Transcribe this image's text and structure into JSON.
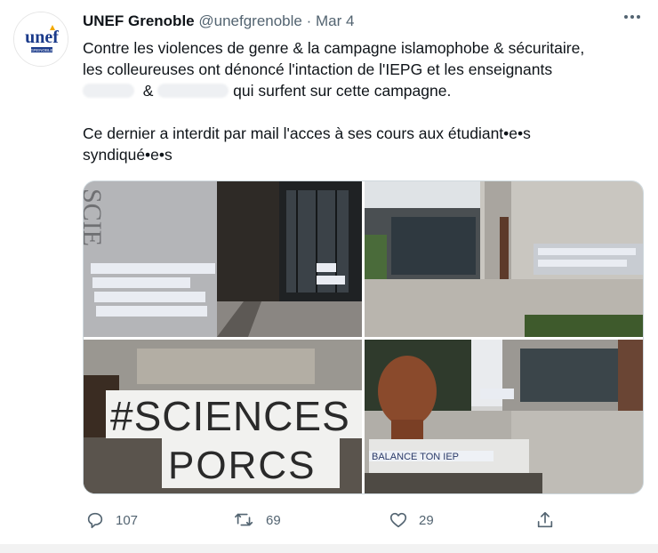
{
  "tweet": {
    "author": {
      "display_name": "UNEF Grenoble",
      "handle": "@unefgrenoble",
      "avatar_logo_text": "unef",
      "avatar_sub_text": "GRENOBLE"
    },
    "separator": "·",
    "date": "Mar 4",
    "more_icon": "more-horizontal-icon",
    "text": {
      "line1": "Contre les violences de genre & la campagne islamophobe & sécuritaire,",
      "line2": "les colleureuses ont dénoncé l'intaction de l'IEPG et les enseignants",
      "line3_amp": "&",
      "line3_rest": "qui surfent sur cette campagne.",
      "para2_line1": "Ce dernier a interdit par mail l'acces à ses cours aux étudiant•e•s",
      "para2_line2": "syndiqué•e•s"
    },
    "photos": {
      "photo1_alt": "collage-on-building-wall",
      "photo3_lines": [
        "#SCIENCES",
        "PORCS"
      ],
      "photo4_caption": "BALANCE TON IEP"
    },
    "actions": {
      "reply_icon": "reply-icon",
      "reply_count": "107",
      "retweet_icon": "retweet-icon",
      "retweet_count": "69",
      "like_icon": "heart-icon",
      "like_count": "29",
      "share_icon": "share-icon"
    },
    "colors": {
      "text": "#0f1419",
      "muted": "#536471",
      "avatar_brand": "#1a3a8a",
      "avatar_accent": "#f2a900"
    }
  }
}
